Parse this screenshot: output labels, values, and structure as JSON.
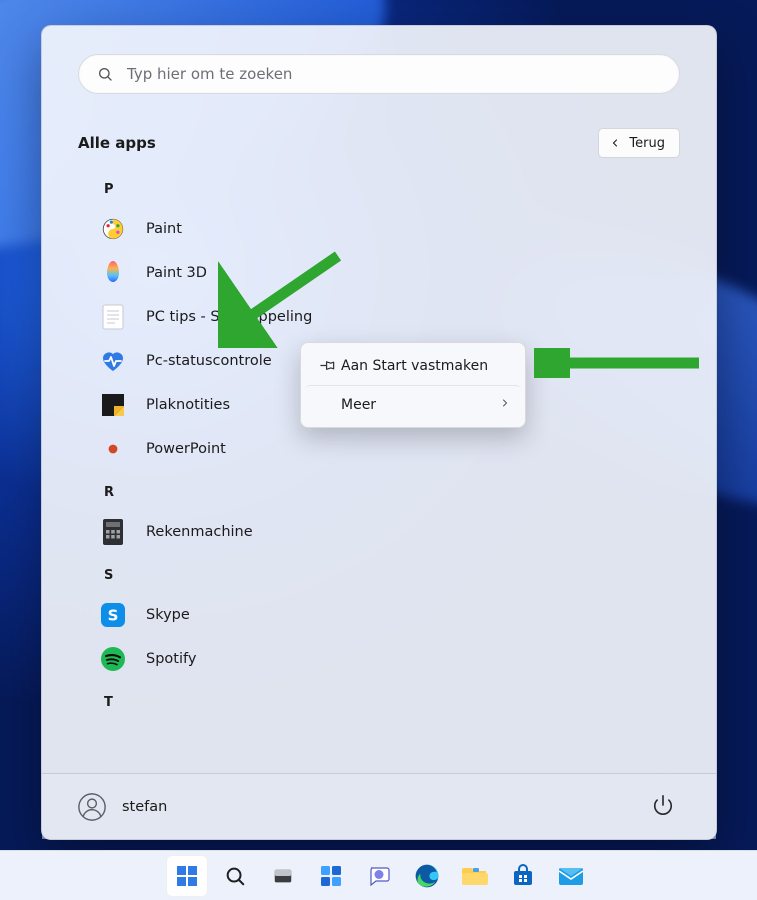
{
  "search": {
    "placeholder": "Typ hier om te zoeken"
  },
  "header": {
    "all_apps": "Alle apps",
    "back": "Terug"
  },
  "letters": {
    "p": "P",
    "r": "R",
    "s": "S",
    "t": "T"
  },
  "apps": {
    "paint": {
      "label": "Paint"
    },
    "paint3d": {
      "label": "Paint 3D"
    },
    "pctips": {
      "label": "PC tips - Snelkoppeling"
    },
    "pcstatus": {
      "label": "Pc-statuscontrole"
    },
    "plaknotities": {
      "label": "Plaknotities"
    },
    "powerpoint": {
      "label": "PowerPoint"
    },
    "rekenmachine": {
      "label": "Rekenmachine"
    },
    "skype": {
      "label": "Skype"
    },
    "spotify": {
      "label": "Spotify"
    }
  },
  "context": {
    "pin": "Aan Start vastmaken",
    "more": "Meer"
  },
  "user": {
    "name": "stefan"
  },
  "colors": {
    "arrow": "#2fa62f"
  }
}
